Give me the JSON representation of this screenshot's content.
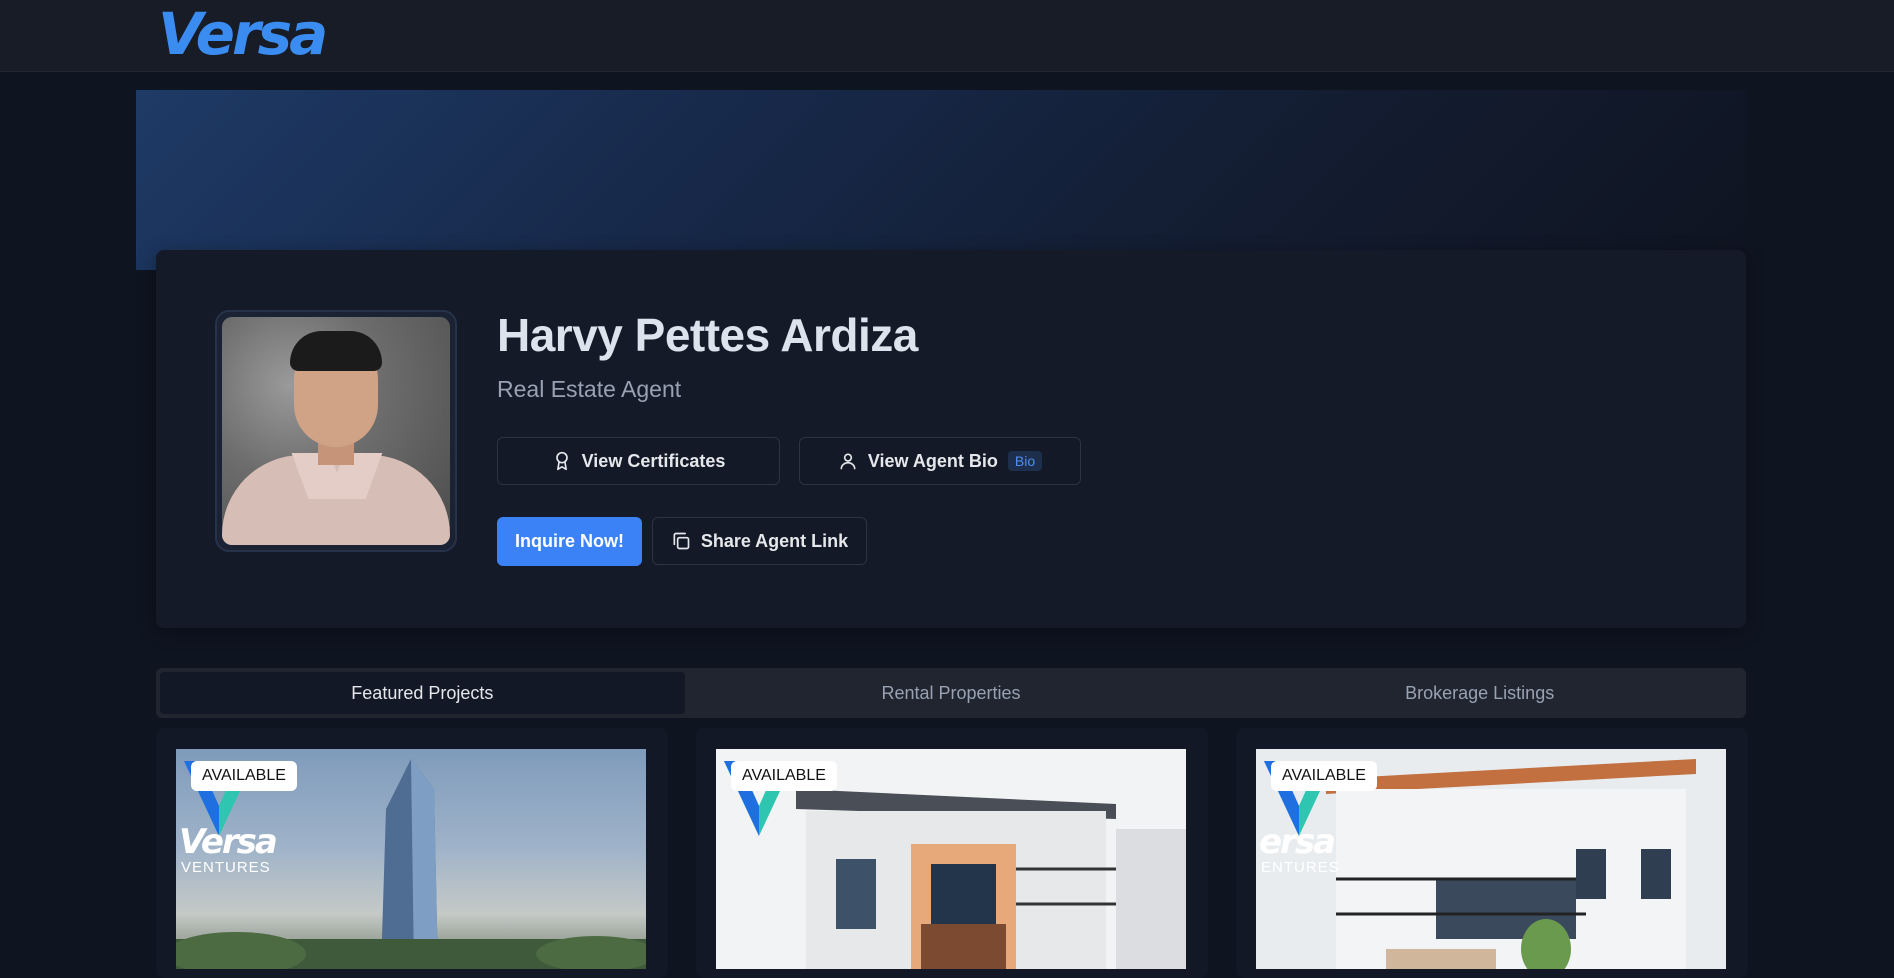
{
  "brand": {
    "logo_text": "Versa"
  },
  "agent": {
    "name": "Harvy Pettes Ardiza",
    "role": "Real Estate Agent"
  },
  "actions": {
    "view_certificates": "View Certificates",
    "view_agent_bio": "View Agent Bio",
    "bio_badge": "Bio",
    "inquire": "Inquire Now!",
    "share_link": "Share Agent Link"
  },
  "tabs": [
    {
      "label": "Featured Projects",
      "active": true
    },
    {
      "label": "Rental Properties",
      "active": false
    },
    {
      "label": "Brokerage Listings",
      "active": false
    }
  ],
  "projects": [
    {
      "status": "AVAILABLE",
      "watermark": "Versa",
      "watermark_sub": "VENTURES"
    },
    {
      "status": "AVAILABLE"
    },
    {
      "status": "AVAILABLE",
      "watermark": "ersa",
      "watermark_sub": "ENTURES"
    }
  ],
  "colors": {
    "background": "#0f1421",
    "accent": "#3b82f6",
    "logo": "#3b8cf0",
    "card": "#141a28"
  }
}
